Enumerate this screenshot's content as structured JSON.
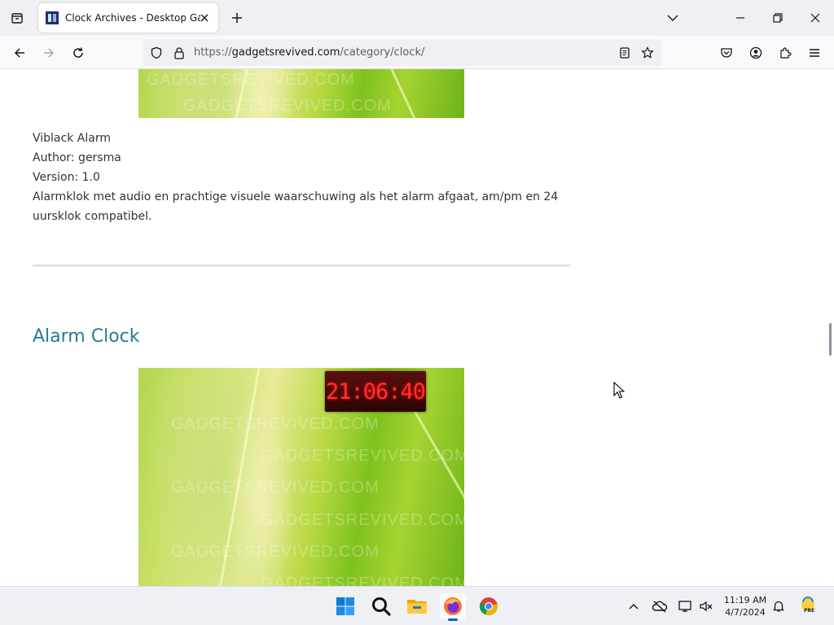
{
  "browser": {
    "tab": {
      "title": "Clock Archives - Desktop Gadg"
    },
    "url": {
      "scheme": "https://",
      "host": "gadgetsrevived.com",
      "path": "/category/clock/"
    }
  },
  "page": {
    "post1": {
      "name": "Viblack Alarm",
      "author": "Author: gersma",
      "version": "Version: 1.0",
      "description": "Alarmklok met audio en prachtige visuele waarschuwing als het alarm afgaat, am/pm en 24 uursklok compatibel."
    },
    "post2": {
      "title": "Alarm Clock",
      "clock_display": "21:06:40"
    },
    "watermark": "GADGETSREVIVED.COM"
  },
  "taskbar": {
    "time": "11:19 AM",
    "date": "4/7/2024",
    "copilot_badge": "PRE"
  }
}
